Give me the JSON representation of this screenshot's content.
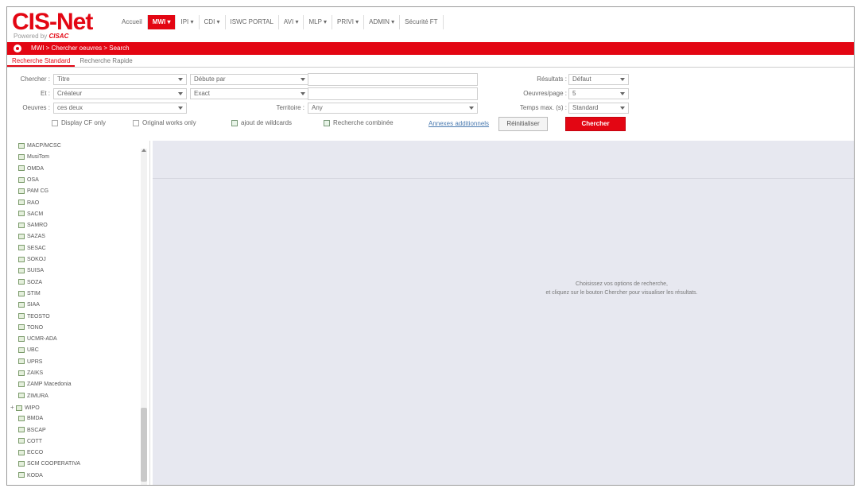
{
  "header": {
    "logo": "CIS-Net",
    "logo_sub_prefix": "Powered by ",
    "logo_sub_brand": "CISAC"
  },
  "topnav": [
    {
      "label": "Accueil",
      "active": false
    },
    {
      "label": "MWI ▾",
      "active": true
    },
    {
      "label": "IPI ▾",
      "active": false
    },
    {
      "label": "CDI ▾",
      "active": false
    },
    {
      "label": "ISWC PORTAL",
      "active": false
    },
    {
      "label": "AVI ▾",
      "active": false
    },
    {
      "label": "MLP ▾",
      "active": false
    },
    {
      "label": "PRIVI ▾",
      "active": false
    },
    {
      "label": "ADMIN ▾",
      "active": false
    },
    {
      "label": "Sécurité FT",
      "active": false
    }
  ],
  "breadcrumb": "MWI > Chercher oeuvres > Search",
  "tabs": [
    "Recherche Standard",
    "Recherche Rapide"
  ],
  "form": {
    "chercher_label": "Chercher :",
    "chercher_value": "Titre",
    "qualifier_value": "Débute par",
    "et_label": "Et :",
    "et_value": "Créateur",
    "match_value": "Exact",
    "societies_label": "Oeuvres :",
    "societies_value": "ces deux",
    "territory_label": "Territoire :",
    "territory_value": "Any",
    "results_label": "Résultats :",
    "results_value": "Défaut",
    "perpage_label": "Oeuvres/page :",
    "perpage_value": "5",
    "timeout_label": "Temps max. (s) :",
    "timeout_value": "Standard",
    "check_display_cf": "Display CF only",
    "check_original": "Original works only",
    "check_wildcards": "ajout de wildcards",
    "check_restricted": "Recherche combinée",
    "link_advanced": "Annexes additionnels",
    "btn_reset": "Réinitialiser",
    "btn_search": "Chercher"
  },
  "tree": {
    "items": [
      {
        "label": "MACP/MCSC",
        "plus": false
      },
      {
        "label": "MusiTom",
        "plus": false
      },
      {
        "label": "OMDA",
        "plus": false
      },
      {
        "label": "OSA",
        "plus": false
      },
      {
        "label": "PAM CG",
        "plus": false
      },
      {
        "label": "RAO",
        "plus": false
      },
      {
        "label": "SACM",
        "plus": false
      },
      {
        "label": "SAMRO",
        "plus": false
      },
      {
        "label": "SAZAS",
        "plus": false
      },
      {
        "label": "SESAC",
        "plus": false
      },
      {
        "label": "SOKOJ",
        "plus": false
      },
      {
        "label": "SUISA",
        "plus": false
      },
      {
        "label": "SOZA",
        "plus": false
      },
      {
        "label": "STIM",
        "plus": false
      },
      {
        "label": "SIAA",
        "plus": false
      },
      {
        "label": "TEOSTO",
        "plus": false
      },
      {
        "label": "TONO",
        "plus": false
      },
      {
        "label": "UCMR-ADA",
        "plus": false
      },
      {
        "label": "UBC",
        "plus": false
      },
      {
        "label": "UPRS",
        "plus": false
      },
      {
        "label": "ZAIKS",
        "plus": false
      },
      {
        "label": "ZAMP Macedonia",
        "plus": false
      },
      {
        "label": "ZIMURA",
        "plus": false
      },
      {
        "label": "WIPO",
        "plus": true
      },
      {
        "label": "BMDA",
        "plus": false
      },
      {
        "label": "BSCAP",
        "plus": false
      },
      {
        "label": "COTT",
        "plus": false
      },
      {
        "label": "ECCO",
        "plus": false
      },
      {
        "label": "SCM COOPERATIVA",
        "plus": false
      },
      {
        "label": "KODA",
        "plus": false
      }
    ]
  },
  "content": {
    "line1": "Choisissez vos options de recherche,",
    "line2": "et cliquez sur le bouton Chercher pour visualiser les résultats."
  },
  "colors": {
    "brand_red": "#e30613",
    "panel_bg": "#e7e8f0"
  }
}
